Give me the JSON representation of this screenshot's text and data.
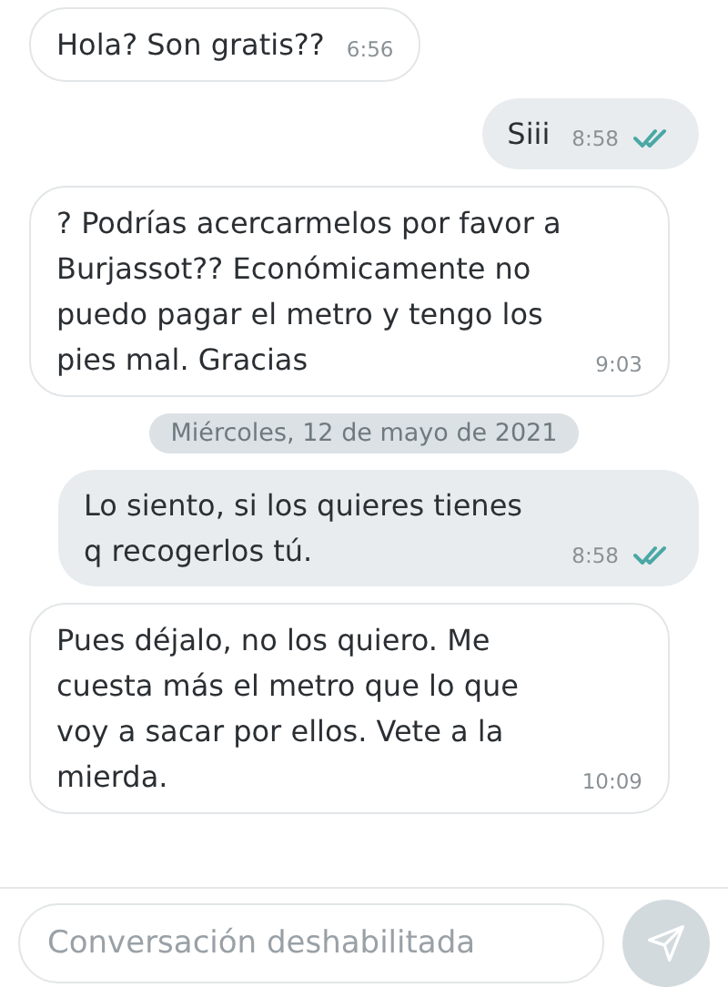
{
  "messages": [
    {
      "kind": "incoming",
      "text": "Hola? Son gratis??",
      "time": "6:56"
    },
    {
      "kind": "outgoing",
      "text": "Siii",
      "time": "8:58",
      "read": true
    },
    {
      "kind": "incoming",
      "text": "? Podrías acercarmelos por favor a Burjassot?? Económicamente no puedo pagar el metro y tengo los pies mal. Gracias",
      "time": "9:03"
    },
    {
      "kind": "date",
      "text": "Miércoles, 12 de mayo de 2021"
    },
    {
      "kind": "outgoing",
      "text": "Lo siento, si los quieres tienes q recogerlos tú.",
      "time": "8:58",
      "read": true
    },
    {
      "kind": "incoming",
      "text": "Pues déjalo, no los quiero. Me cuesta más el metro que lo que voy a sacar por ellos. Vete a la mierda.",
      "time": "10:09"
    }
  ],
  "composer": {
    "placeholder": "Conversación deshabilitada",
    "disabled": true
  }
}
